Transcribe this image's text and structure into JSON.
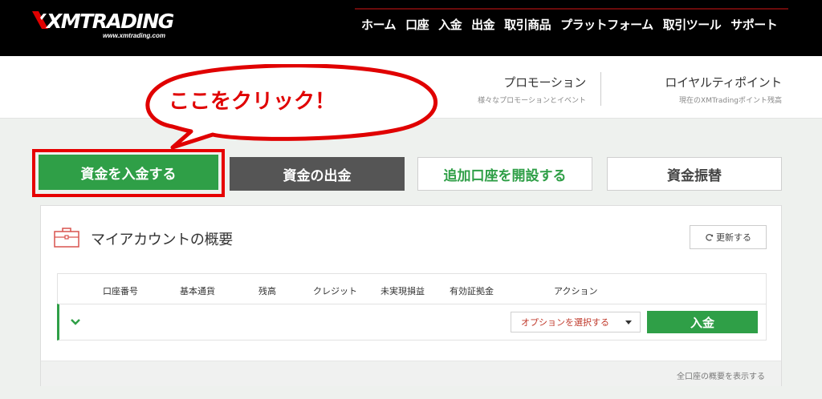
{
  "header": {
    "logo_text": "XMTRADING",
    "logo_sub": "www.xmtrading.com",
    "nav": [
      "ホーム",
      "口座",
      "入金",
      "出金",
      "取引商品",
      "プラットフォーム",
      "取引ツール",
      "サポート"
    ]
  },
  "subnav": {
    "promotion": {
      "title": "プロモーション",
      "sub": "様々なプロモーションとイベント"
    },
    "loyalty": {
      "title": "ロイヤルティポイント",
      "sub": "現在のXMTradingポイント残高"
    }
  },
  "annotation": {
    "callout": "ここをクリック！"
  },
  "actions": {
    "deposit": "資金を入金する",
    "withdraw": "資金の出金",
    "open_account": "追加口座を開設する",
    "transfer": "資金振替"
  },
  "account_panel": {
    "title": "マイアカウントの概要",
    "refresh": "更新する",
    "columns": [
      "口座番号",
      "基本通貨",
      "残高",
      "クレジット",
      "未実現損益",
      "有効証拠金",
      "アクション"
    ],
    "row": {
      "option_select": "オプションを選択する",
      "deposit": "入金"
    },
    "footer_link": "全口座の概要を表示する"
  },
  "colors": {
    "accent_green": "#2f9f47",
    "highlight_red": "#e60000",
    "header_black": "#000000"
  },
  "icons": [
    "briefcase-icon",
    "refresh-icon",
    "chevron-down-icon",
    "caret-down-icon",
    "logo-x-icon"
  ]
}
